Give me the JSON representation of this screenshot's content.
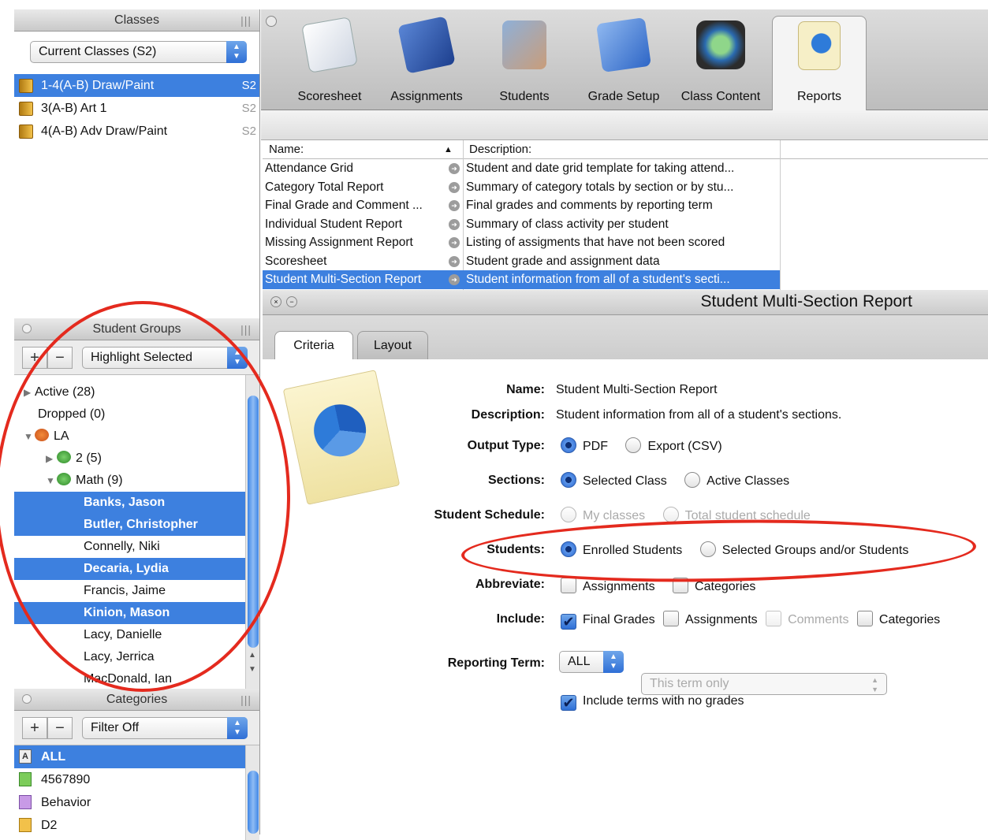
{
  "sidebar": {
    "classes_header": "Classes",
    "classes_popup": "Current Classes (S2)",
    "classes": [
      {
        "label": "1-4(A-B) Draw/Paint",
        "term": "S2"
      },
      {
        "label": "3(A-B) Art 1",
        "term": "S2"
      },
      {
        "label": "4(A-B) Adv Draw/Paint",
        "term": "S2"
      }
    ],
    "groups_header": "Student Groups",
    "groups_popup": "Highlight Selected",
    "groups": {
      "active": "Active (28)",
      "dropped": "Dropped (0)",
      "la": "LA",
      "g2": "2 (5)",
      "math": "Math (9)",
      "students": [
        "Banks, Jason",
        "Butler, Christopher",
        "Connelly, Niki",
        "Decaria, Lydia",
        "Francis, Jaime",
        "Kinion, Mason",
        "Lacy, Danielle",
        "Lacy, Jerrica",
        "MacDonald, Ian"
      ]
    },
    "categories_header": "Categories",
    "categories_popup": "Filter Off",
    "categories": [
      "ALL",
      "4567890",
      "Behavior",
      "D2"
    ]
  },
  "toolbar": {
    "items": [
      "Scoresheet",
      "Assignments",
      "Students",
      "Grade Setup",
      "Class Content",
      "Reports"
    ]
  },
  "reports": {
    "col_name": "Name:",
    "col_desc": "Description:",
    "rows": [
      {
        "name": "Attendance Grid",
        "desc": "Student and date grid template for taking attend..."
      },
      {
        "name": "Category Total Report",
        "desc": "Summary of category totals by section or by stu..."
      },
      {
        "name": "Final Grade and Comment ...",
        "desc": "Final grades and comments by reporting term"
      },
      {
        "name": "Individual Student Report",
        "desc": "Summary of class activity per student"
      },
      {
        "name": "Missing Assignment Report",
        "desc": "Listing of assigments that have not been scored"
      },
      {
        "name": "Scoresheet",
        "desc": "Student grade and assignment data"
      },
      {
        "name": "Student Multi-Section Report",
        "desc": "Student information from all of a student's secti..."
      }
    ]
  },
  "detail": {
    "title": "Student Multi-Section Report",
    "tabs": [
      "Criteria",
      "Layout"
    ],
    "labels": {
      "name": "Name:",
      "description": "Description:",
      "output": "Output Type:",
      "sections": "Sections:",
      "schedule": "Student Schedule:",
      "students": "Students:",
      "abbreviate": "Abbreviate:",
      "include": "Include:",
      "term": "Reporting Term:"
    },
    "name_value": "Student Multi-Section Report",
    "description_value": "Student information from all of a student's sections.",
    "output_options": [
      "PDF",
      "Export (CSV)"
    ],
    "section_options": [
      "Selected Class",
      "Active Classes"
    ],
    "schedule_options": [
      "My classes",
      "Total student schedule"
    ],
    "student_options": [
      "Enrolled Students",
      "Selected Groups and/or Students"
    ],
    "abbreviate_options": [
      "Assignments",
      "Categories"
    ],
    "include_options": [
      "Final Grades",
      "Assignments",
      "Comments",
      "Categories"
    ],
    "term_value": "ALL",
    "term_scope": "This term only",
    "no_grades": "Include terms with no grades"
  },
  "colors": {
    "selection": "#3d80df",
    "annotation": "#e42a1e"
  }
}
